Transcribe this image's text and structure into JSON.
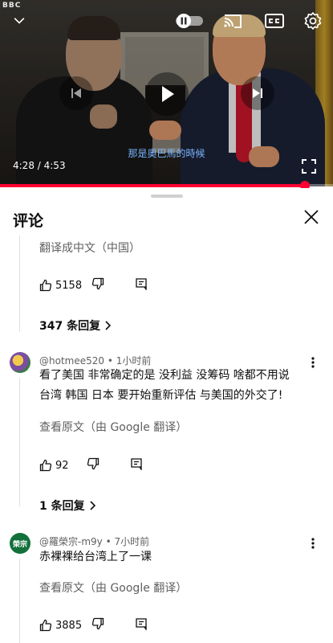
{
  "player": {
    "logo_text": "BBC",
    "subtitle": "那是奧巴馬的時候",
    "current_time": "4:28",
    "duration": "4:53",
    "time_separator": " / ",
    "progress_fraction": 0.915,
    "accent": "#ff0033"
  },
  "sheet": {
    "title": "评论"
  },
  "comments": [
    {
      "translate_label": "翻译成中文（中国）",
      "likes": "5158",
      "replies_label": "347 条回复"
    },
    {
      "author": "@hotmee520",
      "time": "1小时前",
      "text_line_1": "看了美国 非常确定的是 没利益 没筹码 啥都不用说",
      "text_line_2": "台湾 韩国 日本 要开始重新评估 与美国的外交了!",
      "translate_label": "查看原文（由 Google 翻译）",
      "likes": "92",
      "replies_label": "1 条回复"
    },
    {
      "author": "@羅榮宗-m9y",
      "time": "7小时前",
      "avatar_text": "榮宗",
      "text": "赤裸裸给台湾上了一课",
      "translate_label": "查看原文（由 Google 翻译）",
      "likes": "3885"
    }
  ],
  "meta_separator": " • "
}
